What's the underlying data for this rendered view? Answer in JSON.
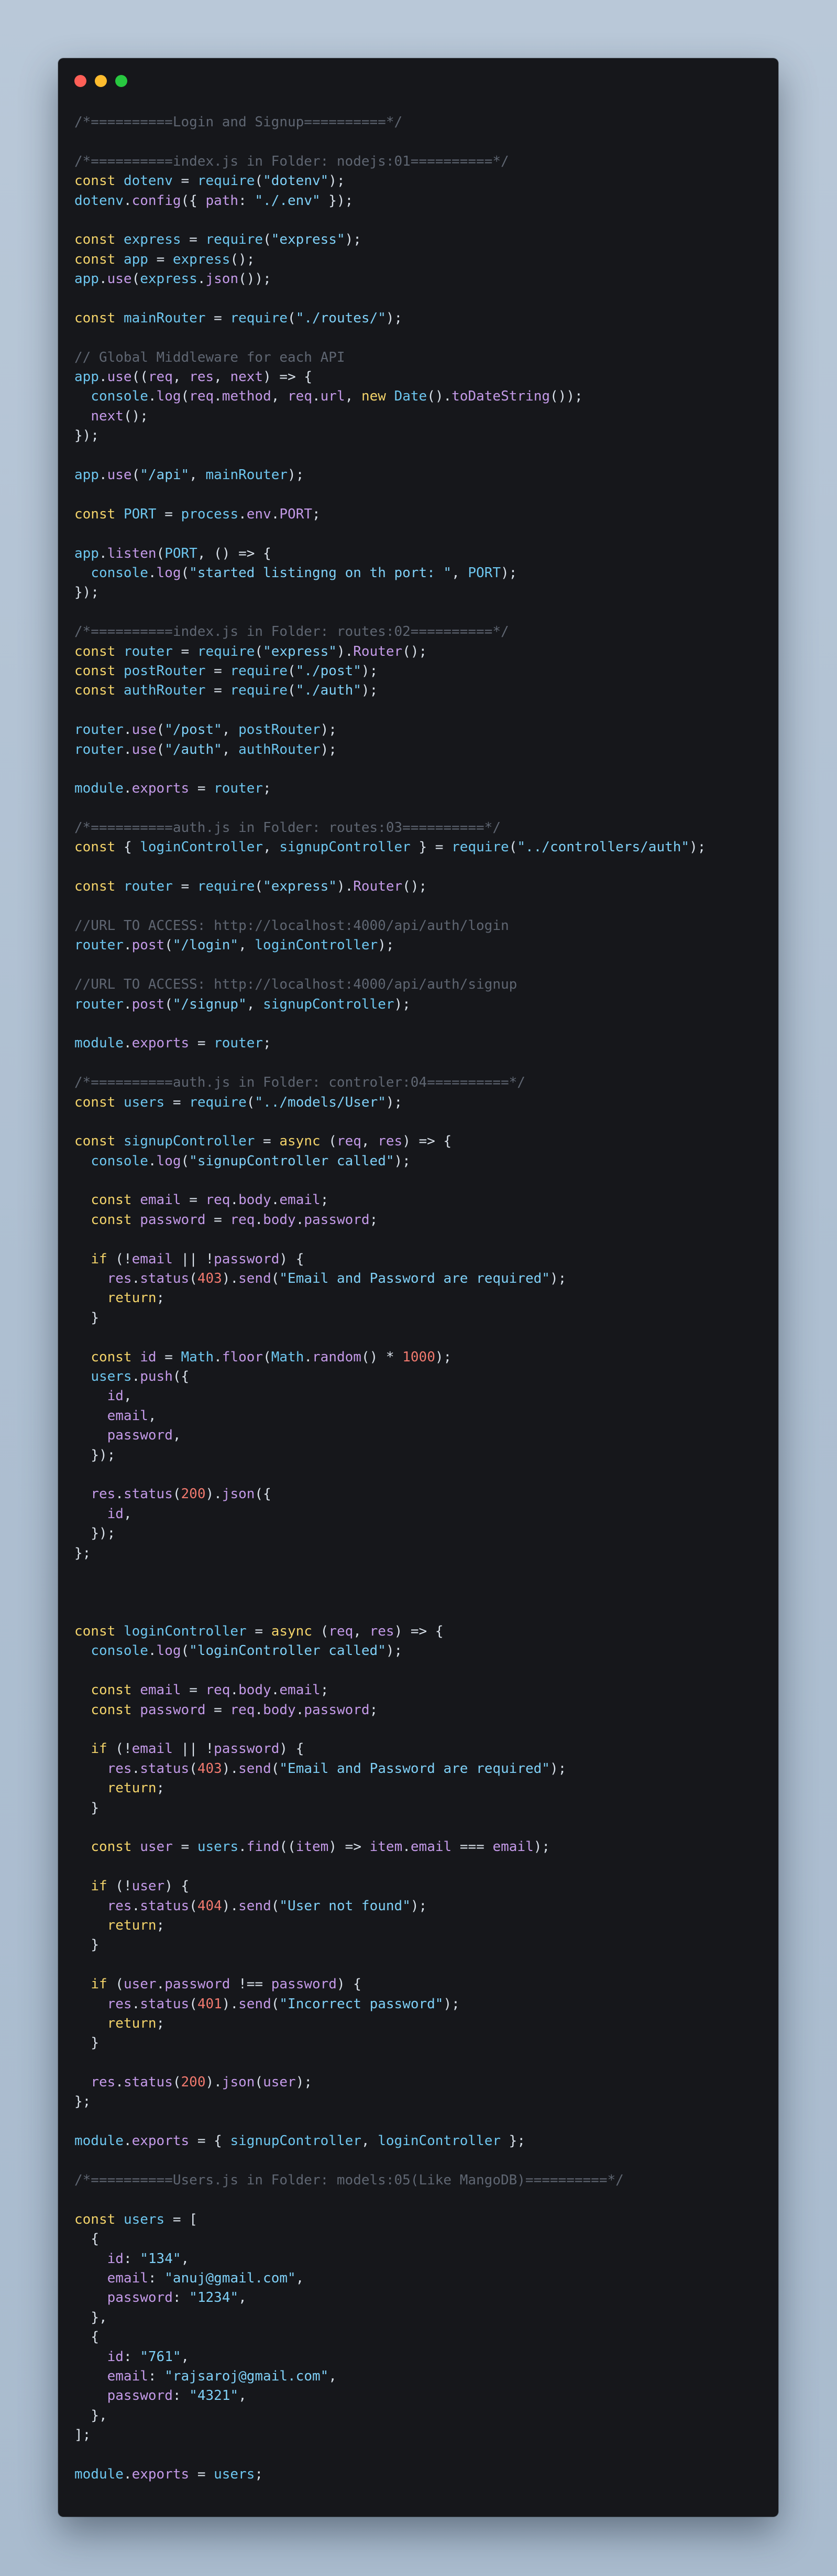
{
  "window": {
    "buttons": [
      "close",
      "minimize",
      "zoom"
    ]
  },
  "colors": {
    "background": "#aebfd1",
    "editor_bg": "#16171b",
    "comment": "#5f6672",
    "keyword": "#f3d36a",
    "identifier": "#6ec7f0",
    "string": "#7fd0f7",
    "property": "#c49ae8",
    "number": "#f27a6f",
    "close_dot": "#fe5f57",
    "minimize_dot": "#febc2e",
    "zoom_dot": "#28c840"
  },
  "code": {
    "language": "javascript",
    "lines": [
      "/*==========Login and Signup==========*/",
      "",
      "/*==========index.js in Folder: nodejs:01==========*/",
      "const dotenv = require(\"dotenv\");",
      "dotenv.config({ path: \"./.env\" });",
      "",
      "const express = require(\"express\");",
      "const app = express();",
      "app.use(express.json());",
      "",
      "const mainRouter = require(\"./routes/\");",
      "",
      "// Global Middleware for each API",
      "app.use((req, res, next) => {",
      "  console.log(req.method, req.url, new Date().toDateString());",
      "  next();",
      "});",
      "",
      "app.use(\"/api\", mainRouter);",
      "",
      "const PORT = process.env.PORT;",
      "",
      "app.listen(PORT, () => {",
      "  console.log(\"started listingng on th port: \", PORT);",
      "});",
      "",
      "/*==========index.js in Folder: routes:02==========*/",
      "const router = require(\"express\").Router();",
      "const postRouter = require(\"./post\");",
      "const authRouter = require(\"./auth\");",
      "",
      "router.use(\"/post\", postRouter);",
      "router.use(\"/auth\", authRouter);",
      "",
      "module.exports = router;",
      "",
      "/*==========auth.js in Folder: routes:03==========*/",
      "const { loginController, signupController } = require(\"../controllers/auth\");",
      "",
      "const router = require(\"express\").Router();",
      "",
      "//URL TO ACCESS: http://localhost:4000/api/auth/login",
      "router.post(\"/login\", loginController);",
      "",
      "//URL TO ACCESS: http://localhost:4000/api/auth/signup",
      "router.post(\"/signup\", signupController);",
      "",
      "module.exports = router;",
      "",
      "/*==========auth.js in Folder: controler:04==========*/",
      "const users = require(\"../models/User\");",
      "",
      "const signupController = async (req, res) => {",
      "  console.log(\"signupController called\");",
      "",
      "  const email = req.body.email;",
      "  const password = req.body.password;",
      "",
      "  if (!email || !password) {",
      "    res.status(403).send(\"Email and Password are required\");",
      "    return;",
      "  }",
      "",
      "  const id = Math.floor(Math.random() * 1000);",
      "  users.push({",
      "    id,",
      "    email,",
      "    password,",
      "  });",
      "",
      "  res.status(200).json({",
      "    id,",
      "  });",
      "};",
      "",
      "",
      "",
      "const loginController = async (req, res) => {",
      "  console.log(\"loginController called\");",
      "",
      "  const email = req.body.email;",
      "  const password = req.body.password;",
      "",
      "  if (!email || !password) {",
      "    res.status(403).send(\"Email and Password are required\");",
      "    return;",
      "  }",
      "",
      "  const user = users.find((item) => item.email === email);",
      "",
      "  if (!user) {",
      "    res.status(404).send(\"User not found\");",
      "    return;",
      "  }",
      "",
      "  if (user.password !== password) {",
      "    res.status(401).send(\"Incorrect password\");",
      "    return;",
      "  }",
      "",
      "  res.status(200).json(user);",
      "};",
      "",
      "module.exports = { signupController, loginController };",
      "",
      "/*==========Users.js in Folder: models:05(Like MangoDB)==========*/",
      "",
      "const users = [",
      "  {",
      "    id: \"134\",",
      "    email: \"anuj@gmail.com\",",
      "    password: \"1234\",",
      "  },",
      "  {",
      "    id: \"761\",",
      "    email: \"rajsaroj@gmail.com\",",
      "    password: \"4321\",",
      "  },",
      "];",
      "",
      "module.exports = users;"
    ]
  }
}
